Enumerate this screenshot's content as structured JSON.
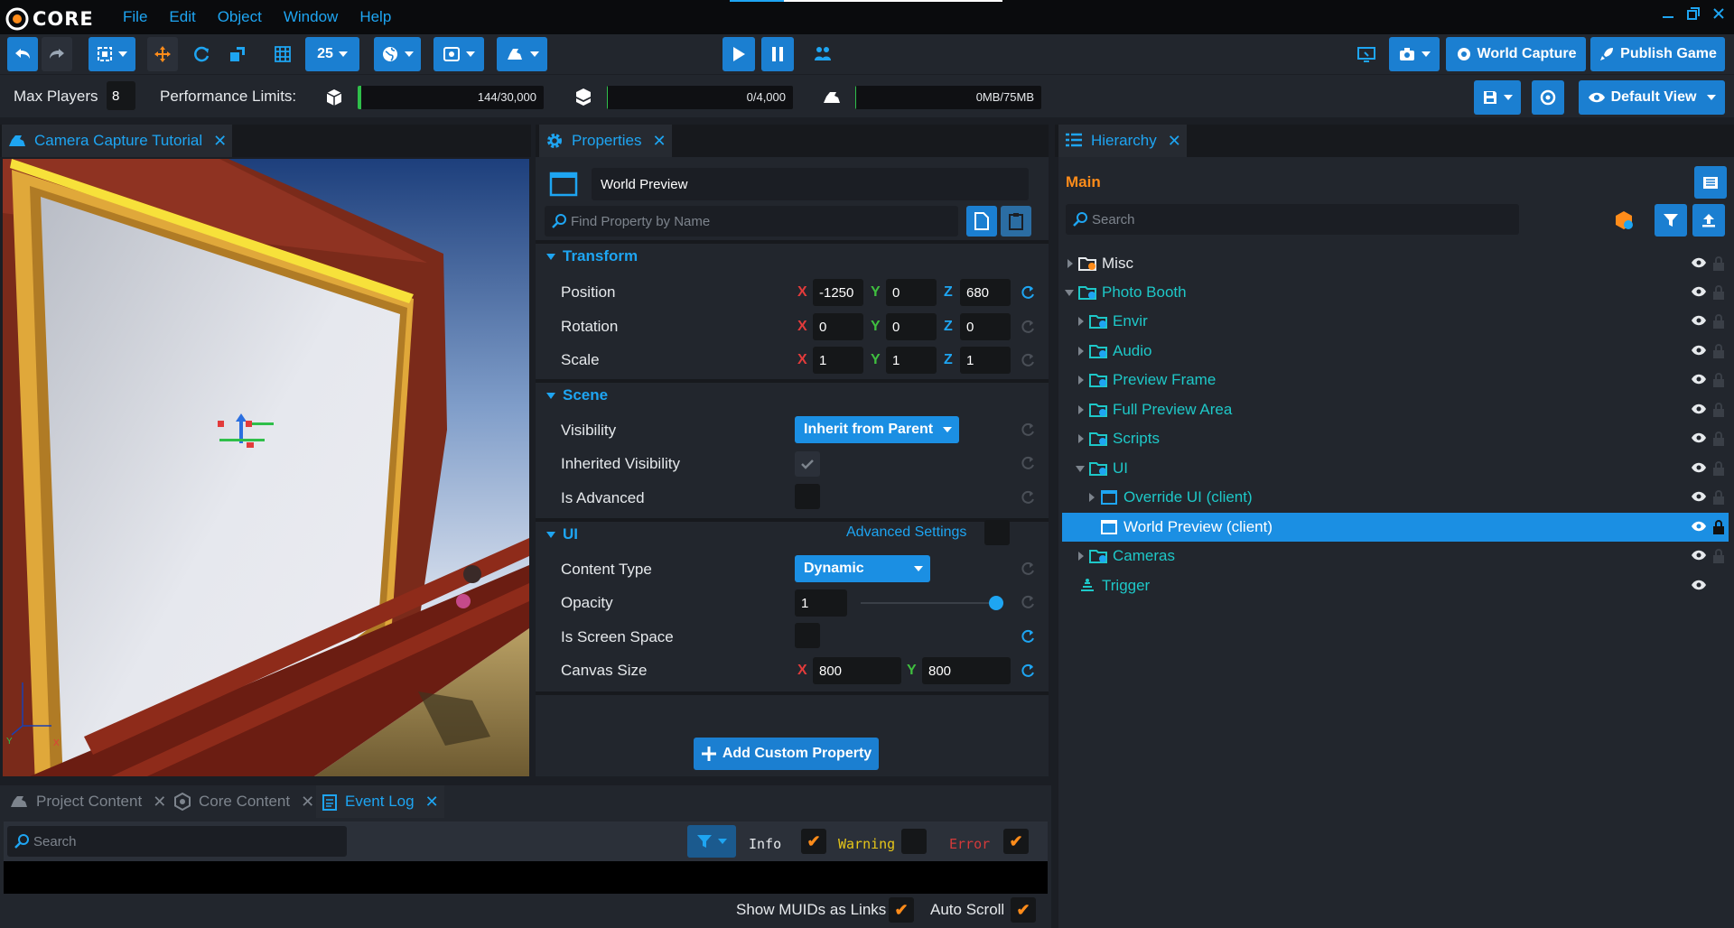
{
  "app": {
    "logo_text": "CORE"
  },
  "menu": [
    "File",
    "Edit",
    "Object",
    "Window",
    "Help"
  ],
  "toolbar": {
    "grid_size": "25",
    "world_capture_label": "World Capture",
    "publish_label": "Publish Game"
  },
  "stats": {
    "max_players_label": "Max Players",
    "max_players_value": "8",
    "perf_label": "Performance Limits:",
    "objects": {
      "text": "144/30,000",
      "fraction": 0.0048
    },
    "networked": {
      "text": "0/4,000",
      "fraction": 0
    },
    "memory": {
      "text": "0MB/75MB",
      "fraction": 0
    },
    "default_view_label": "Default View"
  },
  "viewport_tab": {
    "label": "Camera Capture Tutorial"
  },
  "properties": {
    "tab_label": "Properties",
    "object_name": "World Preview",
    "search_placeholder": "Find Property by Name",
    "sections": {
      "transform": "Transform",
      "scene": "Scene",
      "ui": "UI"
    },
    "position": {
      "label": "Position",
      "x": "-1250",
      "y": "0",
      "z": "680"
    },
    "rotation": {
      "label": "Rotation",
      "x": "0",
      "y": "0",
      "z": "0"
    },
    "scale": {
      "label": "Scale",
      "x": "1",
      "y": "1",
      "z": "1"
    },
    "visibility": {
      "label": "Visibility",
      "value": "Inherit from Parent"
    },
    "inherited_visibility": {
      "label": "Inherited Visibility"
    },
    "is_advanced": {
      "label": "Is Advanced"
    },
    "advanced_settings": "Advanced Settings",
    "content_type": {
      "label": "Content Type",
      "value": "Dynamic"
    },
    "opacity": {
      "label": "Opacity",
      "value": "1",
      "level": 1.0
    },
    "screen_space": {
      "label": "Is Screen Space"
    },
    "canvas_size": {
      "label": "Canvas Size",
      "x": "800",
      "y": "800"
    },
    "add_custom_label": "Add Custom Property"
  },
  "axes": {
    "x": "X",
    "y": "Y",
    "z": "Z"
  },
  "hierarchy": {
    "tab_label": "Hierarchy",
    "root": "Main",
    "search_placeholder": "Search",
    "items": [
      {
        "label": "Misc"
      },
      {
        "label": "Photo Booth"
      },
      {
        "label": "Envir"
      },
      {
        "label": "Audio"
      },
      {
        "label": "Preview Frame"
      },
      {
        "label": "Full Preview Area"
      },
      {
        "label": "Scripts"
      },
      {
        "label": "UI"
      },
      {
        "label": "Override UI (client)"
      },
      {
        "label": "World Preview (client)"
      },
      {
        "label": "Cameras"
      },
      {
        "label": "Trigger"
      }
    ]
  },
  "bottom": {
    "tabs": [
      "Project Content",
      "Core Content",
      "Event Log"
    ],
    "search_placeholder": "Search",
    "info": "Info",
    "warning": "Warning",
    "error": "Error",
    "show_muids": "Show MUIDs as Links",
    "auto_scroll": "Auto Scroll"
  },
  "colors": {
    "accent": "#1ea5f2",
    "selected": "#1b8fe3",
    "hierarchy_text": "#1ec8c8",
    "check": "#ff8c1a"
  }
}
